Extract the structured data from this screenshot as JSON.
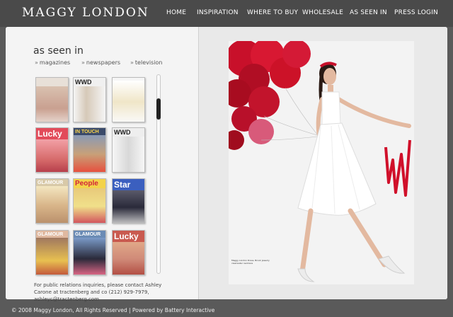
{
  "brand": {
    "logo": "MAGGY LONDON"
  },
  "nav": [
    {
      "label": "HOME"
    },
    {
      "label": "INSPIRATION"
    },
    {
      "label": "WHERE TO BUY"
    },
    {
      "label": "WHOLESALE"
    },
    {
      "label": "AS SEEN IN"
    },
    {
      "label": "PRESS LOGIN"
    }
  ],
  "section": {
    "title": "as seen in",
    "tabs": [
      {
        "label": "magazines"
      },
      {
        "label": "newspapers"
      },
      {
        "label": "television"
      }
    ]
  },
  "thumbnails": [
    {
      "title": "",
      "color": "#e8e0d8"
    },
    {
      "title": "WWD",
      "color": "#f0f0f0"
    },
    {
      "title": "",
      "color": "#f6f6f6"
    },
    {
      "title": "Lucky",
      "color": "#e24b5a"
    },
    {
      "title": "IN TOUCH",
      "color": "#3a4a6a"
    },
    {
      "title": "WWD",
      "color": "#eeeeee"
    },
    {
      "title": "GLAMOUR",
      "color": "#d8c9a8"
    },
    {
      "title": "People",
      "color": "#f3d34a"
    },
    {
      "title": "Star",
      "color": "#3b5fbf"
    },
    {
      "title": "GLAMOUR",
      "color": "#e0b9a0"
    },
    {
      "title": "GLAMOUR",
      "color": "#6a8bb5"
    },
    {
      "title": "Lucky",
      "color": "#c95a4f"
    }
  ],
  "footer": {
    "contact": "For public relations inquiries, please contact Ashley Carone at tractenberg and co (212) 929-7979, ashleyc@tractenberg.com"
  },
  "copyright": "© 2008 Maggy London, All Rights Reserved | Powered by Battery Interactive",
  "photo": {
    "caption": "Maggy London Dress, Brook Jewelry clearwater necklace"
  }
}
